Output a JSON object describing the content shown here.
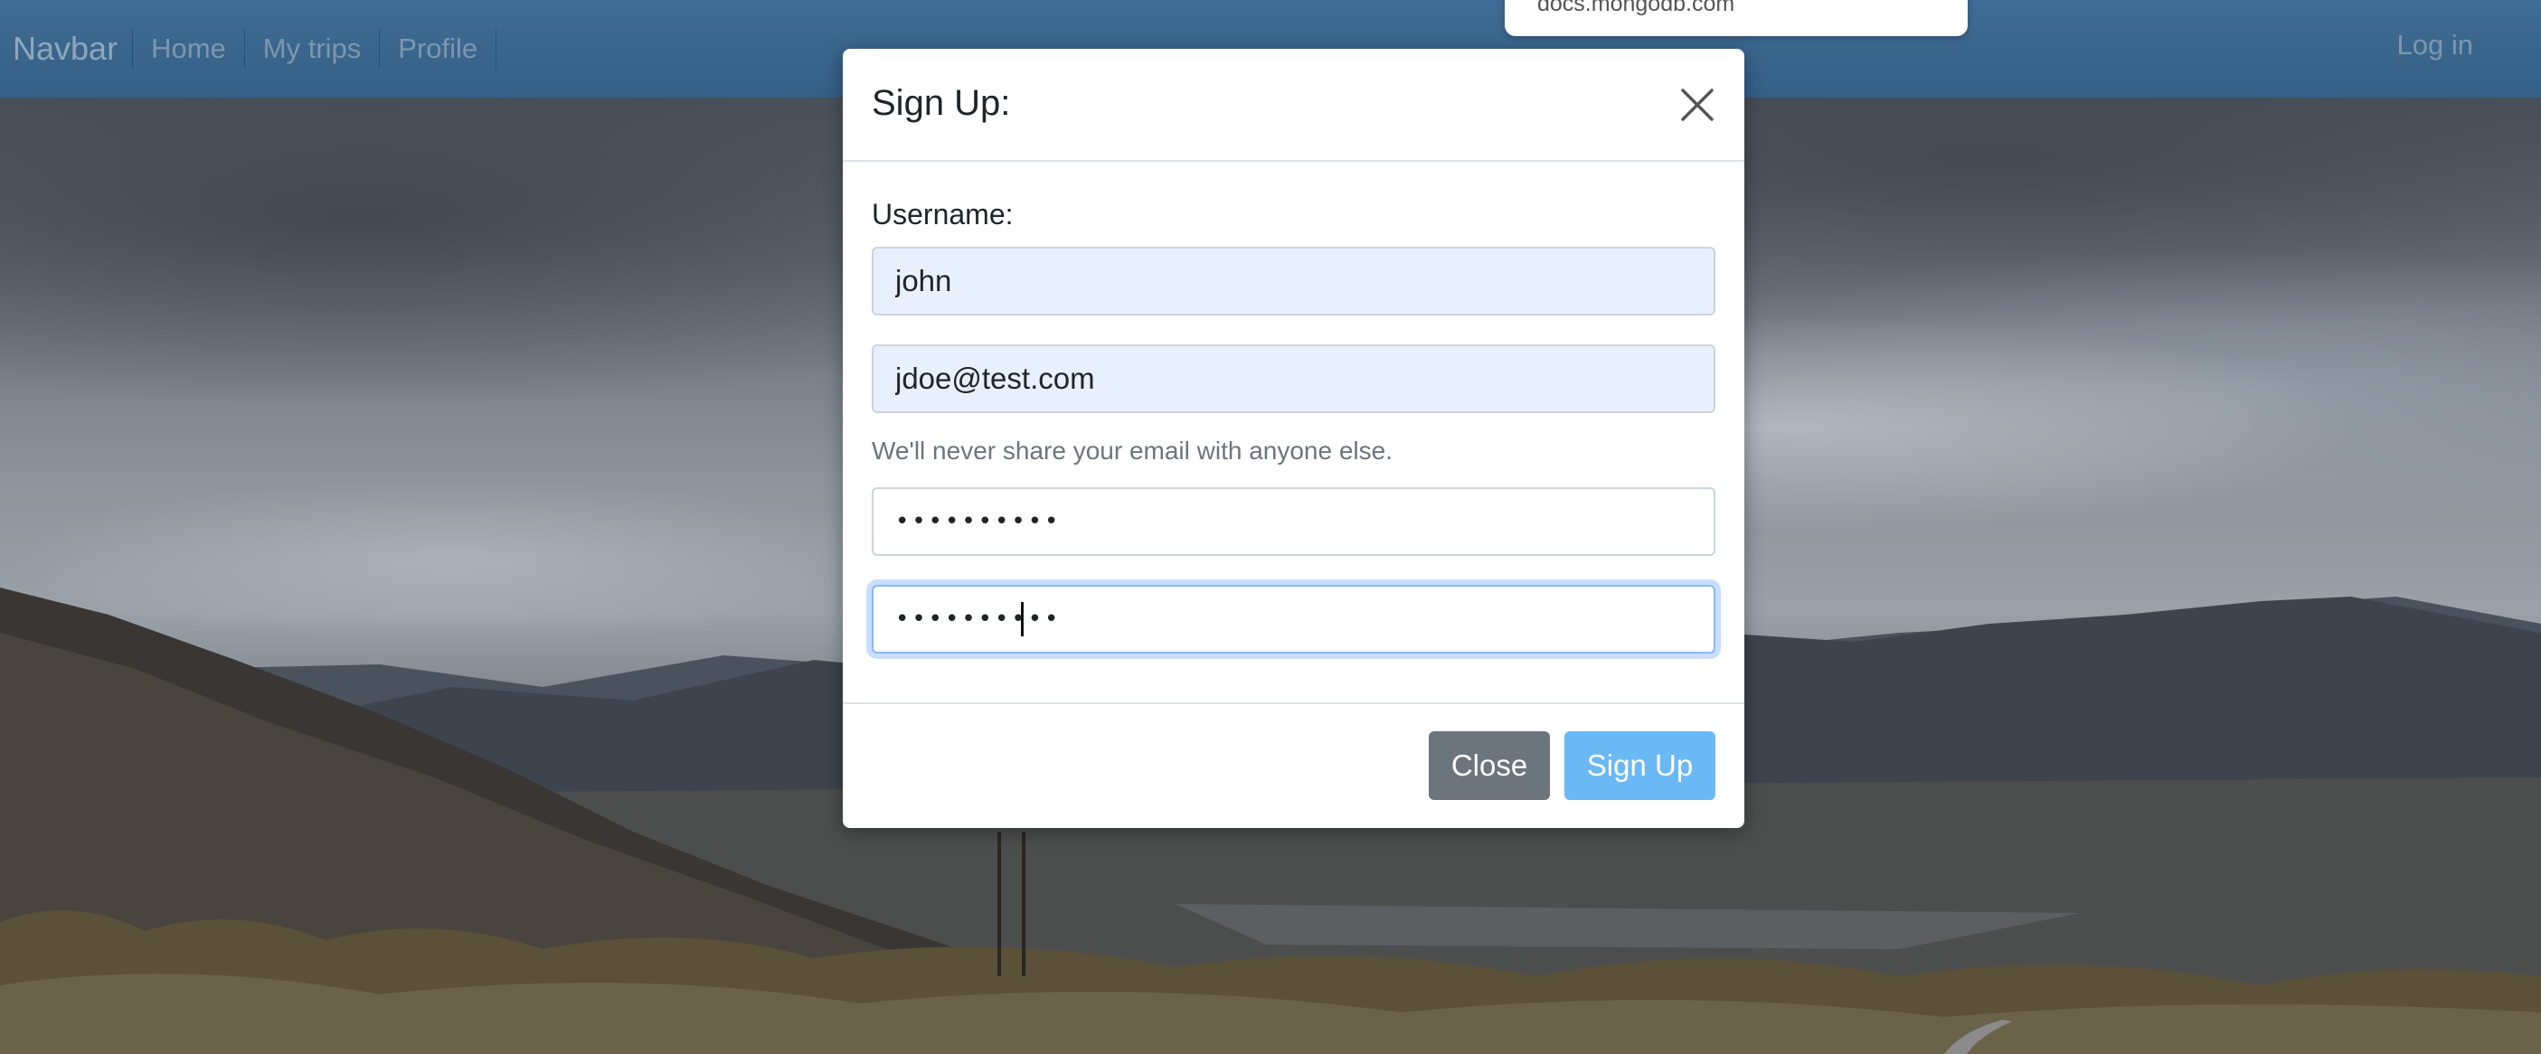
{
  "navbar": {
    "brand": "Navbar",
    "links": [
      "Home",
      "My trips",
      "Profile"
    ],
    "login": "Log in"
  },
  "url_popup": {
    "text": "docs.mongodb.com"
  },
  "modal": {
    "title": "Sign Up:",
    "username_label": "Username:",
    "username_value": "john",
    "email_value": "jdoe@test.com",
    "email_help": "We'll never share your email with anyone else.",
    "password_value": "••••••••••",
    "confirm_password_value": "••••••••••",
    "close_label": "Close",
    "signup_label": "Sign Up"
  },
  "colors": {
    "navbar": "#3b6890",
    "autofill": "#e8f0fe",
    "close_button": "#6c757d",
    "signup_button": "#6ab9f5",
    "focus_ring": "#86b7fe"
  },
  "icons": {
    "close": "close-icon"
  }
}
